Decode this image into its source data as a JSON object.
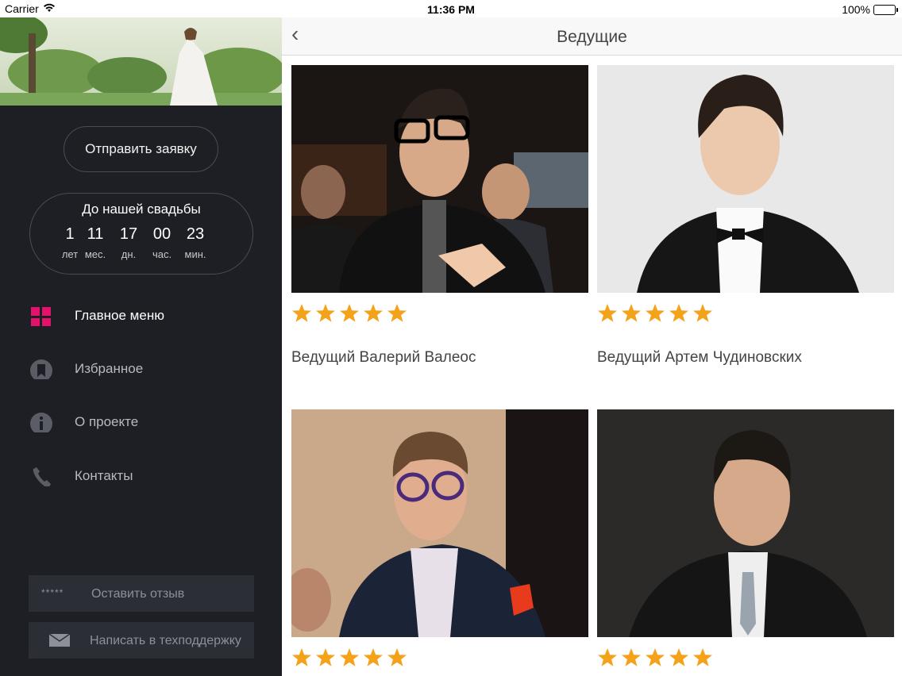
{
  "status_bar": {
    "carrier": "Carrier",
    "time": "11:36 PM",
    "battery": "100%"
  },
  "sidebar": {
    "request_button": "Отправить заявку",
    "countdown": {
      "title": "До нашей свадьбы",
      "cells": [
        {
          "value": "1",
          "unit": "лет"
        },
        {
          "value": "11",
          "unit": "мес."
        },
        {
          "value": "17",
          "unit": "дн."
        },
        {
          "value": "00",
          "unit": "час."
        },
        {
          "value": "23",
          "unit": "мин."
        }
      ]
    },
    "menu": [
      {
        "label": "Главное меню",
        "icon": "grid-icon",
        "active": true
      },
      {
        "label": "Избранное",
        "icon": "bookmark-icon",
        "active": false
      },
      {
        "label": "О проекте",
        "icon": "info-icon",
        "active": false
      },
      {
        "label": "Контакты",
        "icon": "phone-icon",
        "active": false
      }
    ],
    "review_button": {
      "stars_text": "*****",
      "label": "Оставить отзыв"
    },
    "support_button": {
      "icon": "envelope-icon",
      "label": "Написать в техподдержку"
    }
  },
  "nav": {
    "back_icon": "chevron-left-icon",
    "title": "Ведущие"
  },
  "cards": [
    {
      "name": "Ведущий Валерий Валеос",
      "rating": 5
    },
    {
      "name": "Ведущий Артем Чудиновских",
      "rating": 5
    },
    {
      "name": "",
      "rating": 5
    },
    {
      "name": "",
      "rating": 5
    }
  ],
  "colors": {
    "accent": "#e4126b",
    "star": "#f5a21b",
    "sidebar_bg": "#1d1f25"
  }
}
